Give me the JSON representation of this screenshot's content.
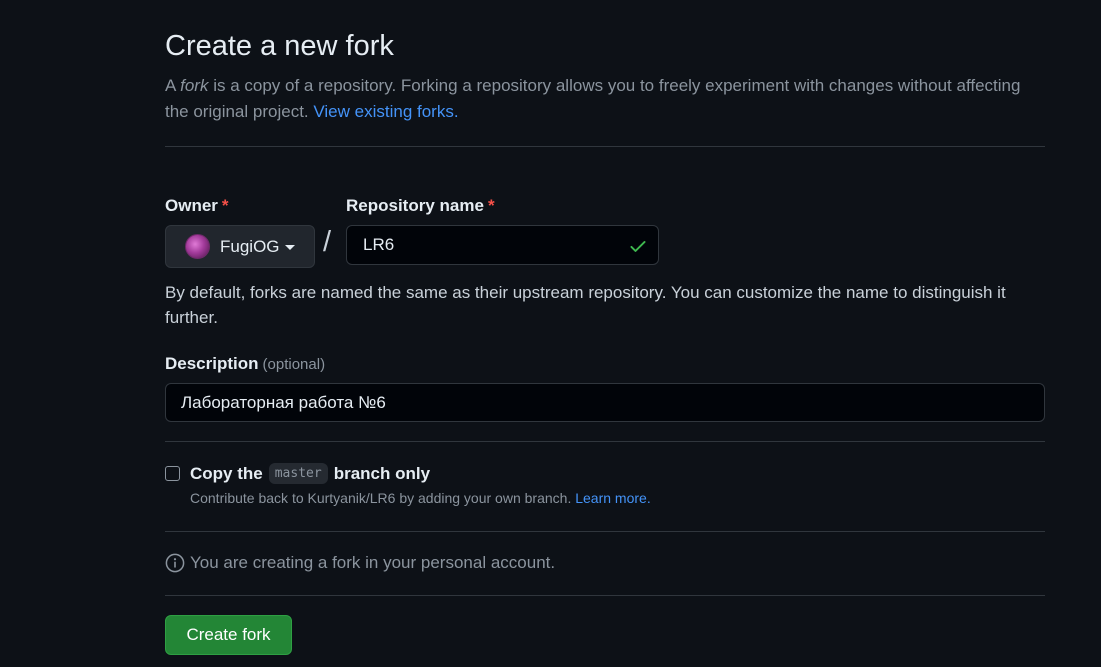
{
  "page_title": "Create a new fork",
  "intro": {
    "before": "A ",
    "fork_word": "fork",
    "after": " is a copy of a repository. Forking a repository allows you to freely experiment with changes without affecting the original project. ",
    "link": "View existing forks."
  },
  "owner": {
    "label": "Owner",
    "required_mark": "*",
    "selected": "FugiOG",
    "avatar_icon": "user-avatar"
  },
  "separator": "/",
  "repository_name": {
    "label": "Repository name",
    "required_mark": "*",
    "value": "LR6",
    "valid_icon": "check-icon"
  },
  "name_hint": "By default, forks are named the same as their upstream repository. You can customize the name to distinguish it further.",
  "description": {
    "label": "Description",
    "optional": "(optional)",
    "value": "Лабораторная работа №6"
  },
  "copy_branch": {
    "checked": false,
    "label_before": "Copy the",
    "branch": "master",
    "label_after": "branch only",
    "sub_text": "Contribute back to Kurtyanik/LR6 by adding your own branch.",
    "learn_more": "Learn more."
  },
  "info": {
    "icon": "info-icon",
    "text": "You are creating a fork in your personal account."
  },
  "submit_label": "Create fork",
  "colors": {
    "background": "#0d1117",
    "link": "#4493f8",
    "required": "#f85149",
    "primary_button": "#238636",
    "valid_check": "#3fb950"
  }
}
